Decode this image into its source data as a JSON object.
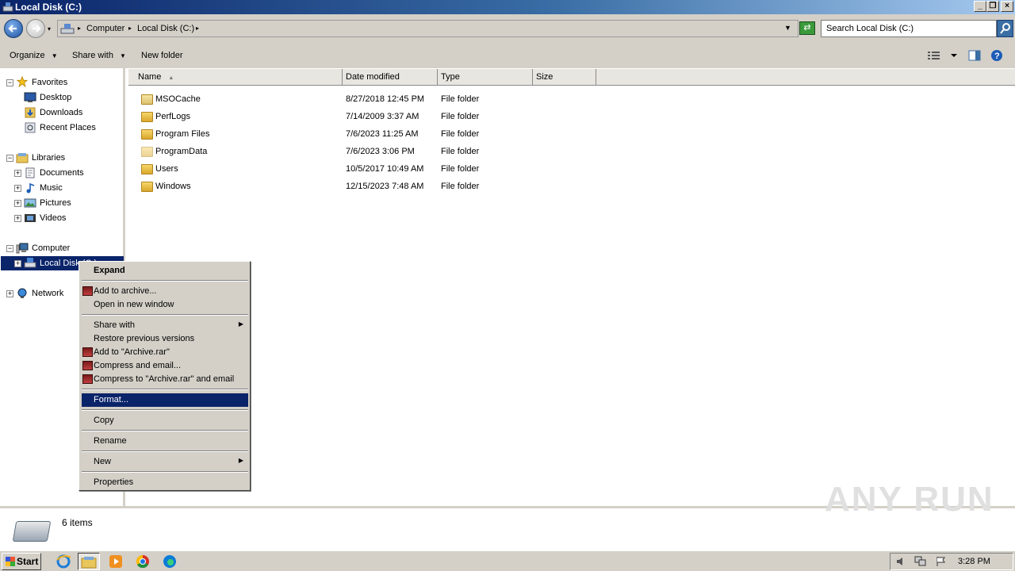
{
  "window": {
    "title": "Local Disk (C:)"
  },
  "address": {
    "crumbs": [
      "Computer",
      "Local Disk (C:)"
    ],
    "search_placeholder": "Search Local Disk (C:)"
  },
  "toolbar": {
    "organize": "Organize",
    "share_with": "Share with",
    "new_folder": "New folder"
  },
  "nav": {
    "favorites": "Favorites",
    "desktop": "Desktop",
    "downloads": "Downloads",
    "recent_places": "Recent Places",
    "libraries": "Libraries",
    "documents": "Documents",
    "music": "Music",
    "pictures": "Pictures",
    "videos": "Videos",
    "computer": "Computer",
    "local_disk": "Local Disk (C:)",
    "network": "Network"
  },
  "columns": {
    "name": "Name",
    "date_modified": "Date modified",
    "type": "Type",
    "size": "Size"
  },
  "files": [
    {
      "name": "MSOCache",
      "date": "8/27/2018 12:45 PM",
      "type": "File folder",
      "size": ""
    },
    {
      "name": "PerfLogs",
      "date": "7/14/2009 3:37 AM",
      "type": "File folder",
      "size": ""
    },
    {
      "name": "Program Files",
      "date": "7/6/2023 11:25 AM",
      "type": "File folder",
      "size": ""
    },
    {
      "name": "ProgramData",
      "date": "7/6/2023 3:06 PM",
      "type": "File folder",
      "size": ""
    },
    {
      "name": "Users",
      "date": "10/5/2017 10:49 AM",
      "type": "File folder",
      "size": ""
    },
    {
      "name": "Windows",
      "date": "12/15/2023 7:48 AM",
      "type": "File folder",
      "size": ""
    }
  ],
  "context_menu": {
    "expand": "Expand",
    "add_to_archive": "Add to archive...",
    "open_new_window": "Open in new window",
    "share_with": "Share with",
    "restore_previous": "Restore previous versions",
    "add_to_archive_rar": "Add to \"Archive.rar\"",
    "compress_email": "Compress and email...",
    "compress_rar_email": "Compress to \"Archive.rar\" and email",
    "format": "Format...",
    "copy": "Copy",
    "rename": "Rename",
    "new": "New",
    "properties": "Properties"
  },
  "details": {
    "item_count": "6 items"
  },
  "taskbar": {
    "start": "Start",
    "clock": "3:28 PM"
  },
  "watermark": "ANY RUN",
  "colors": {
    "selection": "#0a246a",
    "chrome": "#d4d0c8"
  }
}
